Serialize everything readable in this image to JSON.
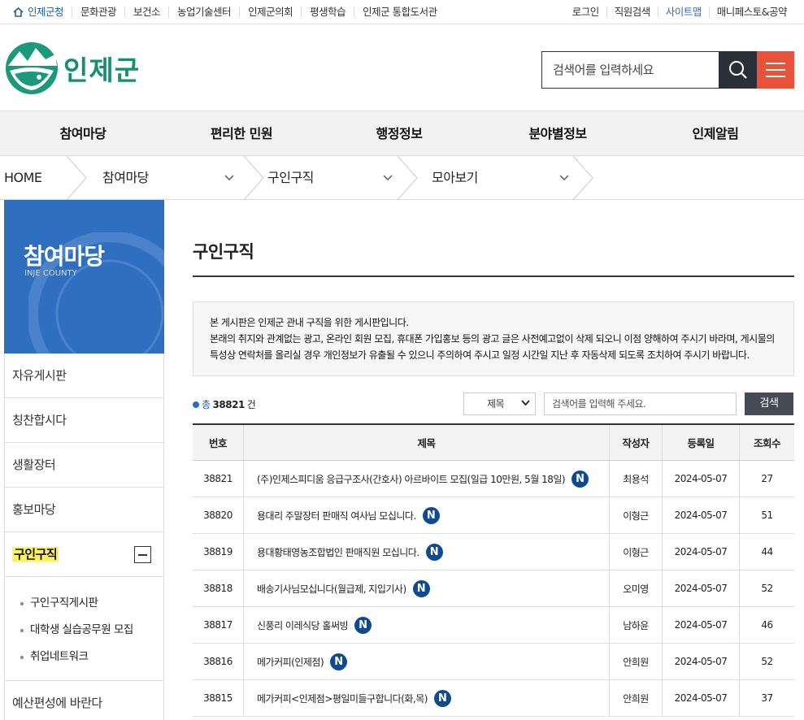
{
  "topbar": {
    "left": [
      "인제군청",
      "문화관광",
      "보건소",
      "농업기술센터",
      "인제군의회",
      "평생학습",
      "인제군 통합도서관"
    ],
    "right": [
      "로그인",
      "직원검색",
      "사이트맵",
      "매니페스토&공약"
    ],
    "highlight_color": "#2b6cc4"
  },
  "logo": {
    "text": "인제군"
  },
  "search": {
    "placeholder": "검색어를 입력하세요"
  },
  "gnb": [
    "참여마당",
    "편리한 민원",
    "행정정보",
    "분야별정보",
    "인제알림"
  ],
  "breadcrumb": {
    "home": "HOME",
    "items": [
      "참여마당",
      "구인구직",
      "모아보기"
    ]
  },
  "lnb": {
    "title": "참여마당",
    "subtitle": "INJE COUNTY",
    "items_before": [
      "자유게시판",
      "칭찬합시다",
      "생활장터",
      "홍보마당"
    ],
    "active": "구인구직",
    "sub": [
      "구인구직게시판",
      "대학생 실습공무원 모집",
      "취업네트워크"
    ],
    "items_after": [
      "예산편성에 바란다"
    ]
  },
  "content": {
    "title": "구인구직",
    "notice": [
      "본 게시판은 인제군 관내 구직을 위한 게시판입니다.",
      "본래의 취지와 관계없는 광고, 온라인 회원 모집, 휴대폰 가입홍보 등의 광고 글은 사전예고없이 삭제 되오니 이점 양해하여 주시기 바라며, 게시물의 특성상 연락처를 올리실 경우 개인정보가 유출될 수 있으니 주의하여 주시고 일정 시간일 지난 후 자동삭제 되도록 조치하여 주시기 바랍니다."
    ],
    "count_prefix": "총",
    "count": "38821",
    "count_suffix": "건",
    "select_value": "제목",
    "keyword_placeholder": "검색어를 입력해 주세요.",
    "search_btn": "검색"
  },
  "table": {
    "headers": [
      "번호",
      "제목",
      "작성자",
      "등록일",
      "조회수"
    ],
    "badge": "N",
    "rows": [
      {
        "no": "38821",
        "title": "(주)인제스피디움 응급구조사(간호사) 아르바이트 모집(일급 10만원, 5월 18일)",
        "author": "최용석",
        "date": "2024-05-07",
        "views": "27"
      },
      {
        "no": "38820",
        "title": "용대리 주말장터 판매직 여사님 모십니다.",
        "author": "이형근",
        "date": "2024-05-07",
        "views": "51"
      },
      {
        "no": "38819",
        "title": "용대황태영농조합법인 판매직원 모십니다.",
        "author": "이형근",
        "date": "2024-05-07",
        "views": "44"
      },
      {
        "no": "38818",
        "title": "배송기사님모십니다(월급제, 지입기사)",
        "author": "오미영",
        "date": "2024-05-07",
        "views": "52"
      },
      {
        "no": "38817",
        "title": "신풍리 이레식당 홀써빙",
        "author": "남하윤",
        "date": "2024-05-07",
        "views": "46"
      },
      {
        "no": "38816",
        "title": "메가커피(인제점)",
        "author": "안희원",
        "date": "2024-05-07",
        "views": "52"
      },
      {
        "no": "38815",
        "title": "메가커피<인제점>평일미들구합니다(화,목)",
        "author": "안희원",
        "date": "2024-05-07",
        "views": "37"
      }
    ]
  }
}
